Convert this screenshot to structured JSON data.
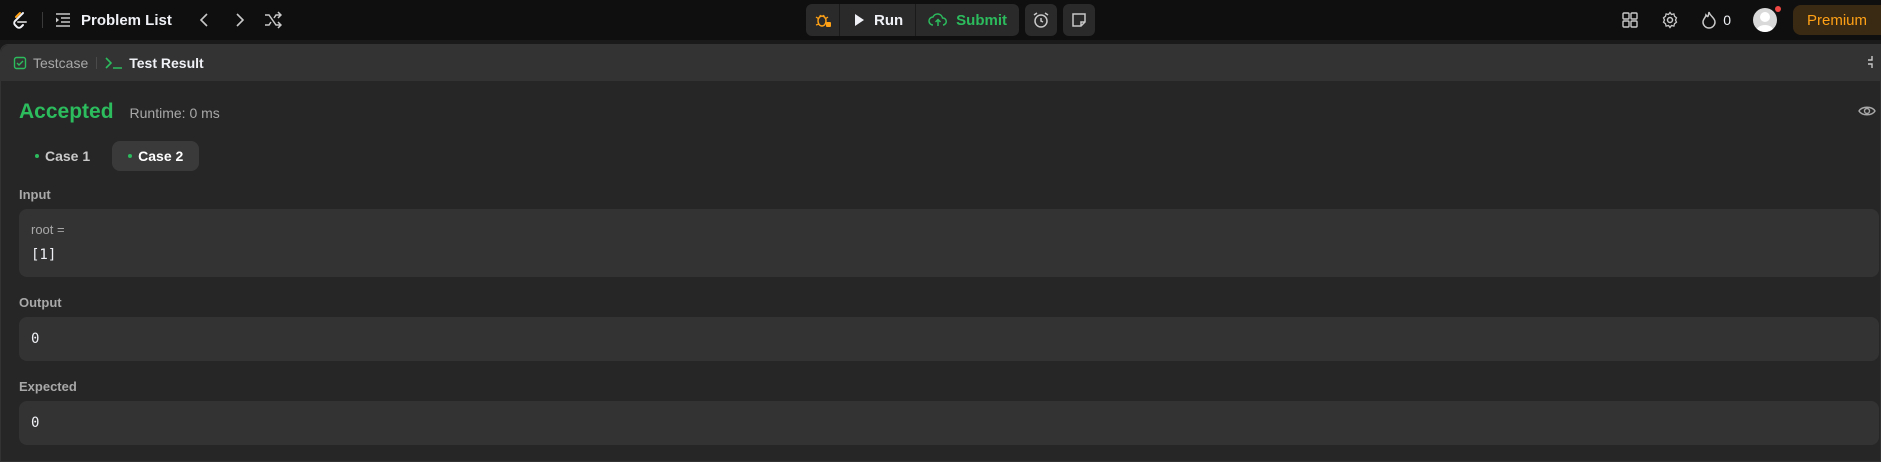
{
  "nav": {
    "problem_list_label": "Problem List",
    "run_label": "Run",
    "submit_label": "Submit",
    "streak_count": "0",
    "premium_label": "Premium"
  },
  "panel": {
    "tabs": [
      {
        "label": "Testcase"
      },
      {
        "label": "Test Result"
      }
    ]
  },
  "result": {
    "status": "Accepted",
    "runtime": "Runtime: 0 ms",
    "cases": [
      {
        "label": "Case 1"
      },
      {
        "label": "Case 2"
      }
    ],
    "input_label": "Input",
    "input_var": "root =",
    "input_value": "[1]",
    "output_label": "Output",
    "output_value": "0",
    "expected_label": "Expected",
    "expected_value": "0"
  },
  "colors": {
    "accent_green": "#2cbb5d",
    "premium_orange": "#ffa116",
    "background": "#1a1a1a",
    "panel": "#262626"
  }
}
